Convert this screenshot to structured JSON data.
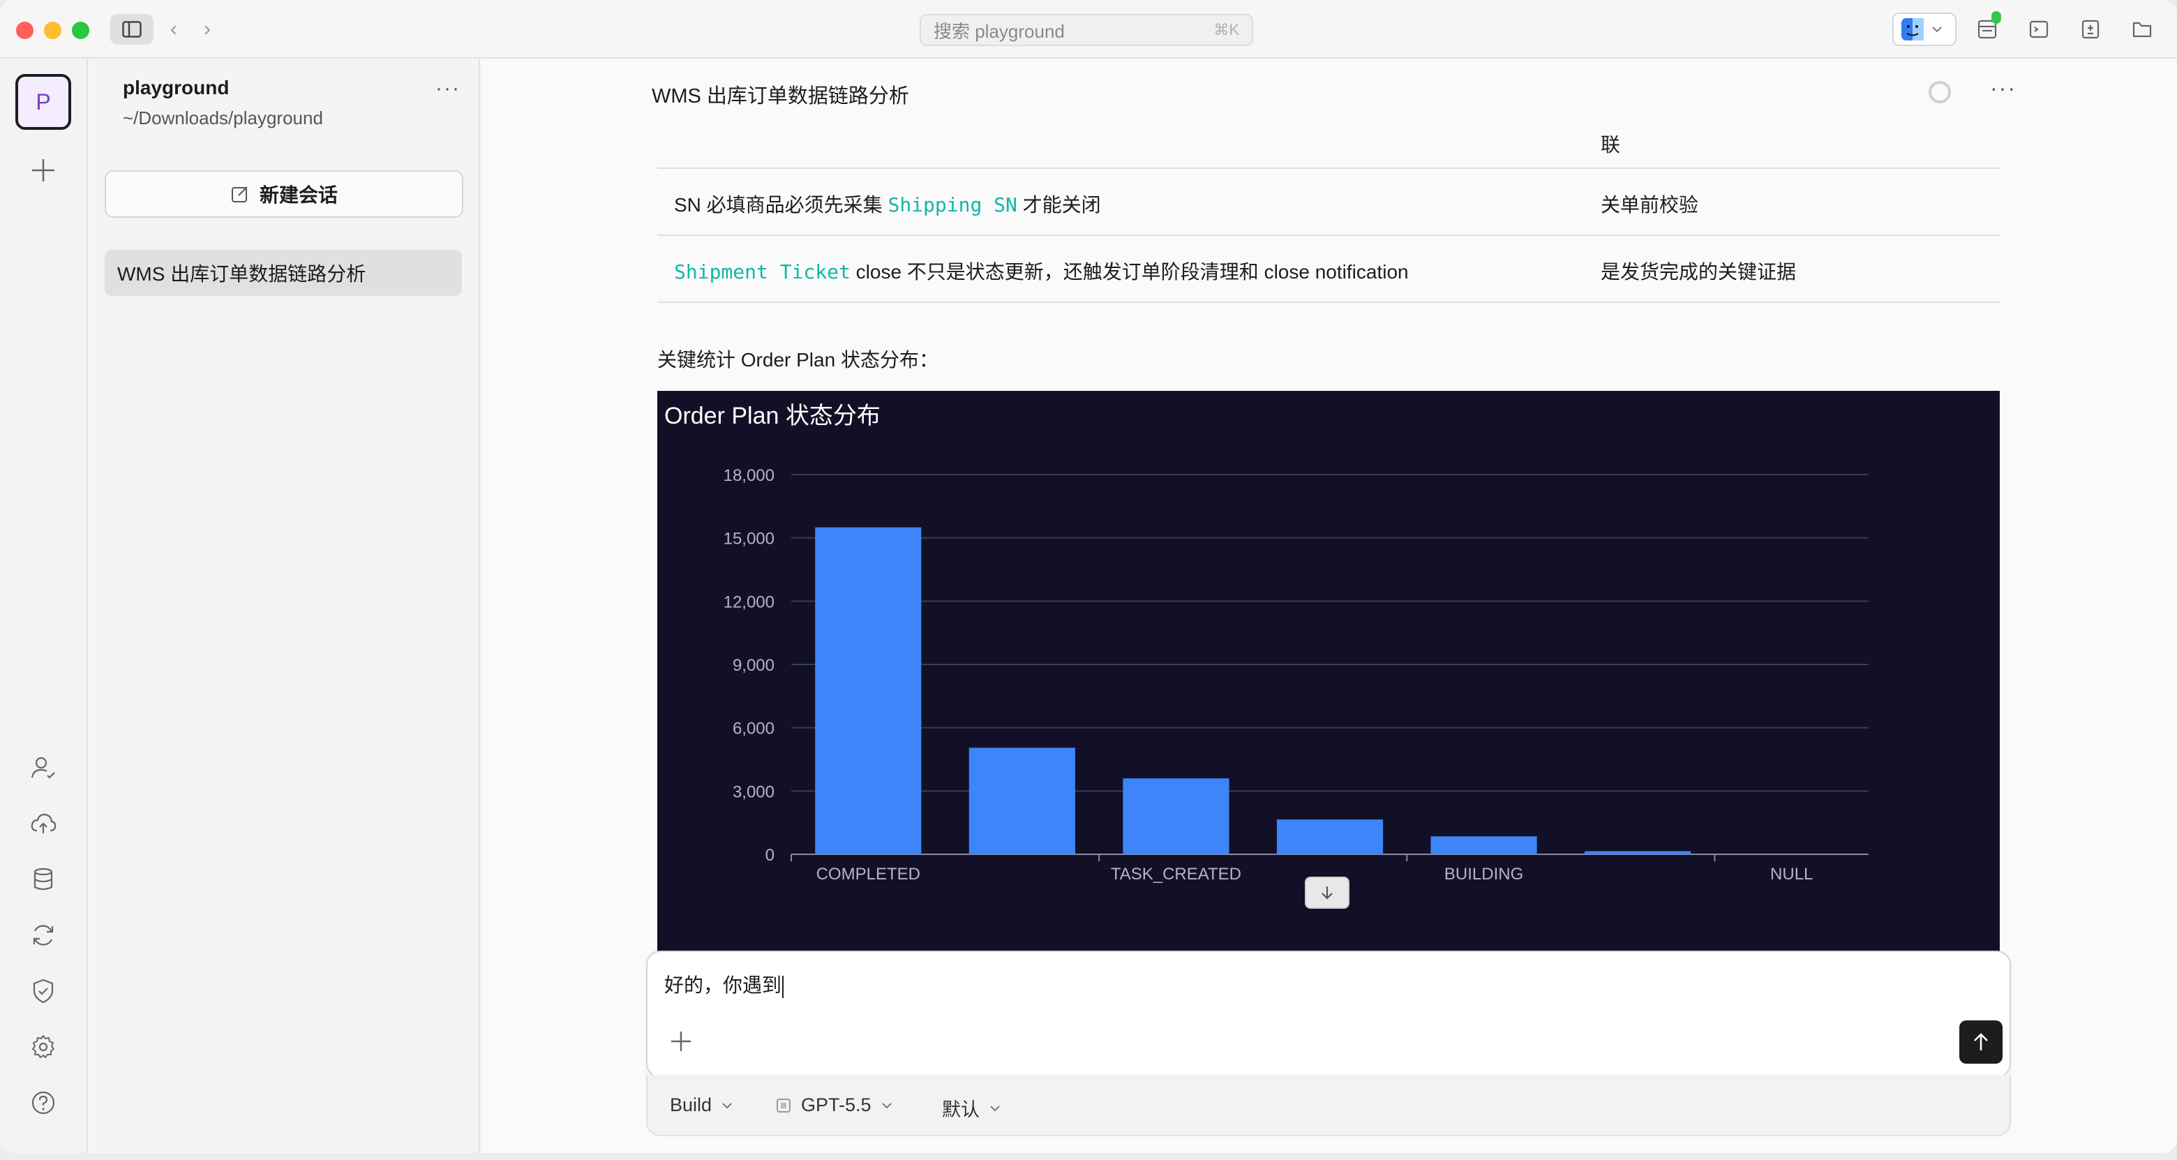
{
  "titlebar": {
    "search_placeholder": "搜索 playground",
    "search_shortcut": "⌘K"
  },
  "rail": {
    "avatar_letter": "P"
  },
  "project": {
    "name": "playground",
    "path": "~/Downloads/playground",
    "more": "···",
    "new_chat_label": "新建会话",
    "sessions": [
      {
        "label": "WMS 出库订单数据链路分析"
      }
    ]
  },
  "main": {
    "title": "WMS 出库订单数据链路分析",
    "more": "···",
    "table_rows": [
      {
        "a_segments": [],
        "b": "联"
      },
      {
        "a_segments": [
          {
            "text": "SN 必填商品必须先采集 ",
            "code": false
          },
          {
            "text": "Shipping SN",
            "code": true
          },
          {
            "text": " 才能关闭",
            "code": false
          }
        ],
        "b": "关单前校验"
      },
      {
        "a_segments": [
          {
            "text": "Shipment Ticket",
            "code": true
          },
          {
            "text": " close 不只是状态更新，还触发订单阶段清理和 close notification",
            "code": false
          }
        ],
        "b": "是发货完成的关键证据"
      }
    ],
    "stat_label": "关键统计 Order Plan 状态分布："
  },
  "chart_data": {
    "type": "bar",
    "title": "Order Plan 状态分布",
    "categories": [
      "COMPLETED",
      "",
      "TASK_CREATED",
      "",
      "BUILDING",
      "",
      "NULL"
    ],
    "series": [
      {
        "values": [
          15500,
          5050,
          3600,
          1650,
          850,
          150,
          0
        ]
      }
    ],
    "ylim": [
      0,
      18000
    ],
    "yticks": [
      "0",
      "3,000",
      "6,000",
      "9,000",
      "12,000",
      "15,000",
      "18,000"
    ],
    "bar_color": "#3d85f8",
    "background": "#121026",
    "grid": true
  },
  "composer": {
    "text": "好的，你遇到",
    "mode": "Build",
    "model": "GPT-5.5",
    "preset": "默认"
  }
}
